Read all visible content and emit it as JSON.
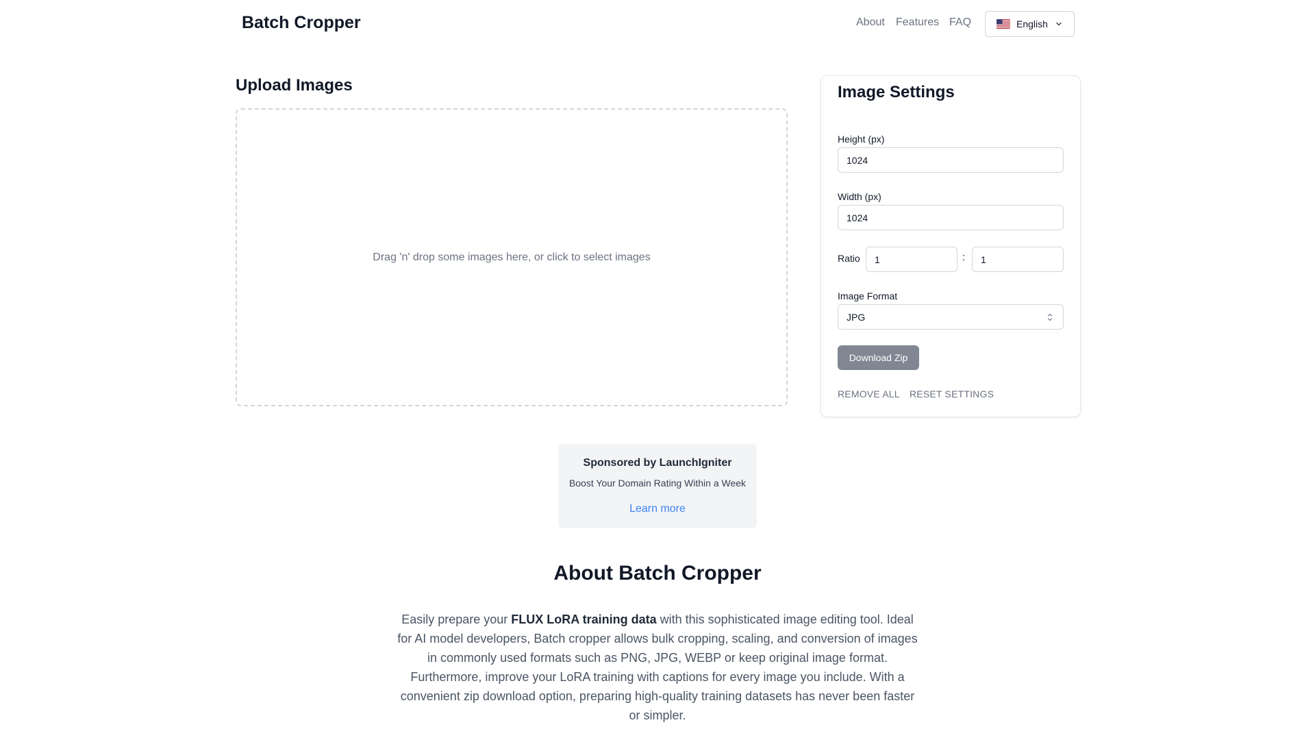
{
  "header": {
    "brand": "Batch Cropper",
    "nav": [
      "About",
      "Features",
      "FAQ"
    ],
    "language": "English",
    "language_flag_icon": "us-flag-icon"
  },
  "upload": {
    "title": "Upload Images",
    "dropzone_text": "Drag 'n' drop some images here, or click to select images"
  },
  "settings": {
    "title": "Image Settings",
    "height_label": "Height (px)",
    "height_value": "1024",
    "width_label": "Width (px)",
    "width_value": "1024",
    "ratio_label": "Ratio",
    "ratio_left": "1",
    "ratio_separator": ":",
    "ratio_right": "1",
    "format_label": "Image Format",
    "format_value": "JPG",
    "download_label": "Download Zip",
    "remove_all_label": "REMOVE ALL",
    "reset_label": "RESET SETTINGS"
  },
  "sponsor": {
    "title": "Sponsored by LaunchIgniter",
    "subtitle": "Boost Your Domain Rating Within a Week",
    "link": "Learn more"
  },
  "about": {
    "title": "About Batch Cropper",
    "text_before": "Easily prepare your ",
    "text_bold": "FLUX LoRA training data",
    "text_after": " with this sophisticated image editing tool. Ideal for AI model developers, Batch cropper allows bulk cropping, scaling, and conversion of images in commonly used formats such as PNG, JPG, WEBP or keep original image format. Furthermore, improve your LoRA training with captions for every image you include. With a convenient zip download option, preparing high-quality training datasets has never been faster or simpler."
  },
  "colors": {
    "link": "#3b82f6",
    "button_bg": "#6b7280",
    "text_muted": "#6b7280"
  }
}
